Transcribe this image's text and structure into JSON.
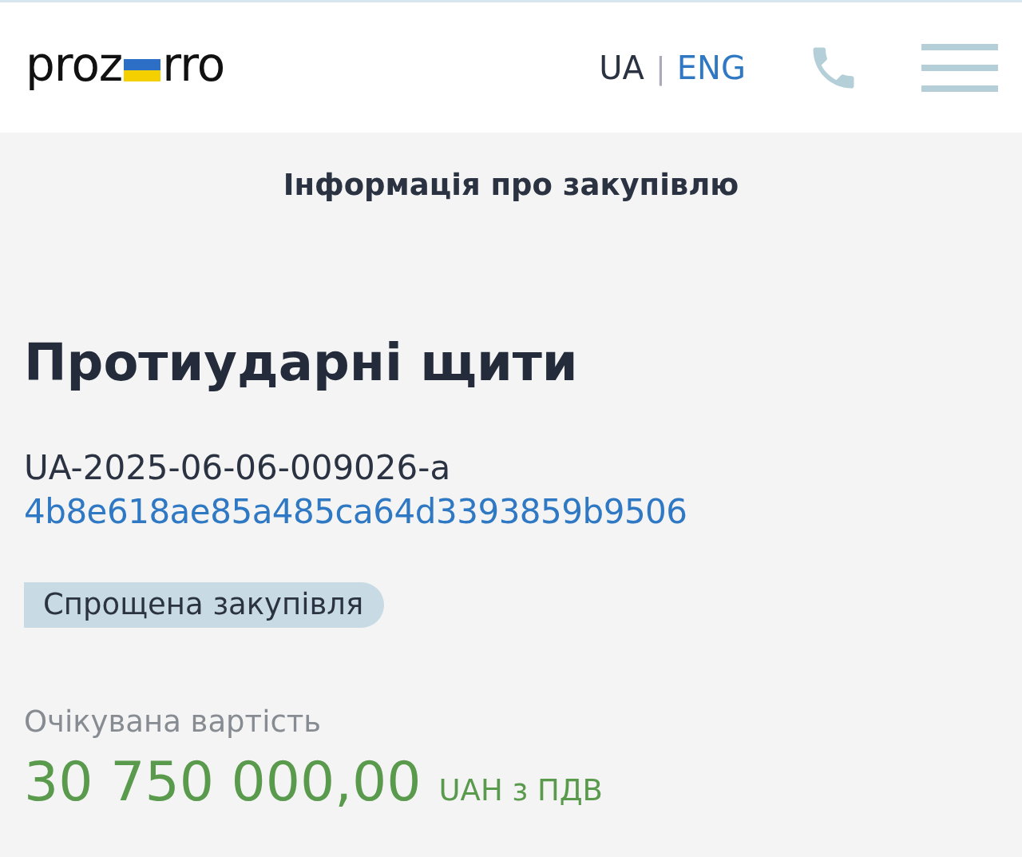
{
  "header": {
    "logo": {
      "left": "proz",
      "right": "rro"
    },
    "languages": [
      {
        "label": "UA",
        "selected": true
      },
      {
        "label": "ENG",
        "selected": false
      }
    ],
    "separator": "|"
  },
  "page_title": "Інформація про закупівлю",
  "tender": {
    "title": "Протиударні щити",
    "id": "UA-2025-06-06-009026-a",
    "hash": "4b8e618ae85a485ca64d3393859b9506",
    "type_badge": "Спрощена закупівля"
  },
  "expected_value": {
    "label": "Очікувана вартість",
    "amount": "30 750 000,00",
    "currency": "UAH з ПДВ"
  }
}
